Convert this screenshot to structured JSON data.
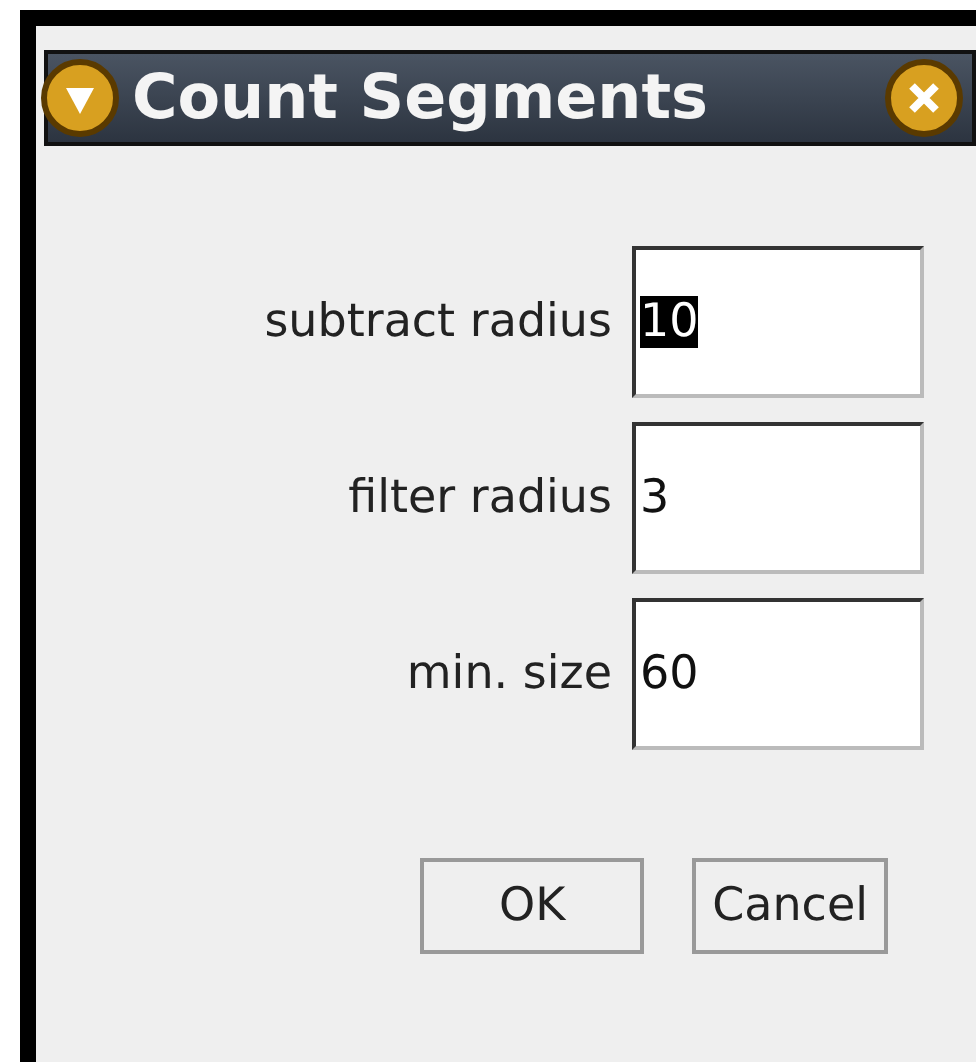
{
  "window": {
    "title": "Count Segments"
  },
  "fields": [
    {
      "label": "subtract radius",
      "value": "10",
      "text_selected": true
    },
    {
      "label": "filter radius",
      "value": "3",
      "text_selected": false
    },
    {
      "label": "min. size",
      "value": "60",
      "text_selected": false
    }
  ],
  "buttons": [
    "OK",
    "Cancel"
  ]
}
